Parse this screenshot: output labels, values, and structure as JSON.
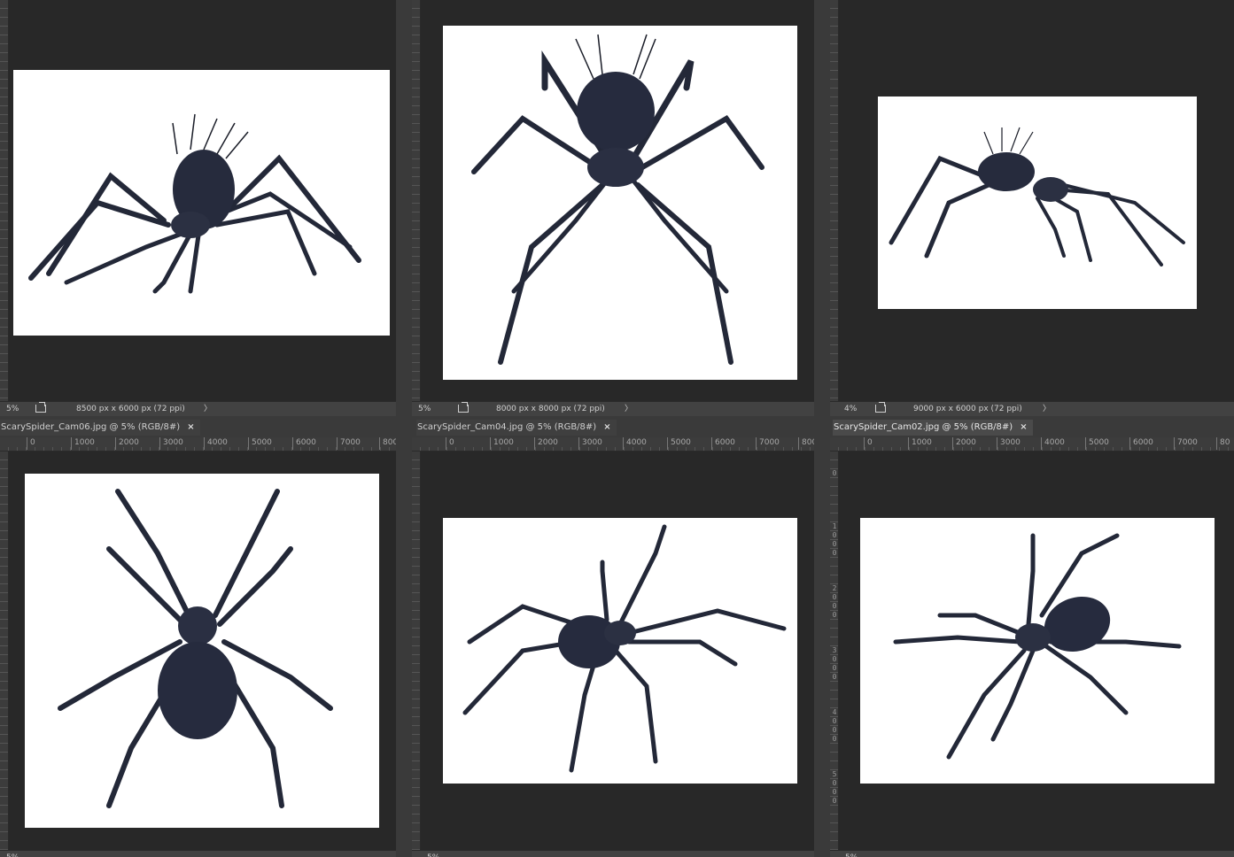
{
  "accent_colors": {
    "panel_bg": "#282828",
    "ruler_bg": "#3c3c3c",
    "status_bg": "#424242",
    "spider": "#252a3a"
  },
  "top_row": [
    {
      "zoom": "5%",
      "dims": "8500 px x 6000 px (72 ppi)",
      "ruler_v": [
        "0",
        "1000",
        "2000",
        "3000",
        "4000",
        "5000",
        "6000",
        "7000",
        "8"
      ],
      "spider_view": "side"
    },
    {
      "zoom": "5%",
      "dims": "8000 px x 8000 px (72 ppi)",
      "ruler_v": [
        "0",
        "1000",
        "2000",
        "3000",
        "4000",
        "5000",
        "6000",
        "7000",
        "8"
      ],
      "spider_view": "front"
    },
    {
      "zoom": "4%",
      "dims": "9000 px x 6000 px (72 ppi)",
      "ruler_v": [
        "0",
        "2000",
        "2000",
        "4000",
        "5000",
        "6000",
        "7000",
        "8"
      ],
      "spider_view": "side-low"
    }
  ],
  "bottom_row": [
    {
      "tab": "ScarySpider_Cam06.jpg @ 5% (RGB/8#)",
      "close": "×",
      "ruler_h": [
        "0",
        "1000",
        "2000",
        "3000",
        "4000",
        "5000",
        "6000",
        "7000",
        "800"
      ],
      "spider_view": "top",
      "zoom": "5%"
    },
    {
      "tab": "ScarySpider_Cam04.jpg @ 5% (RGB/8#)",
      "close": "×",
      "ruler_h": [
        "0",
        "1000",
        "2000",
        "3000",
        "4000",
        "5000",
        "6000",
        "7000",
        "800"
      ],
      "spider_view": "three-quarter",
      "zoom": "5%"
    },
    {
      "tab": "ScarySpider_Cam02.jpg @ 5% (RGB/8#)",
      "close": "×",
      "ruler_h": [
        "0",
        "1000",
        "2000",
        "3000",
        "4000",
        "5000",
        "6000",
        "7000",
        "80"
      ],
      "ruler_v": [
        "0",
        "1000",
        "2000",
        "3000",
        "4000",
        "5000",
        "6000"
      ],
      "spider_view": "top-angled",
      "zoom": "5%"
    }
  ],
  "arrow_glyph": "〉"
}
